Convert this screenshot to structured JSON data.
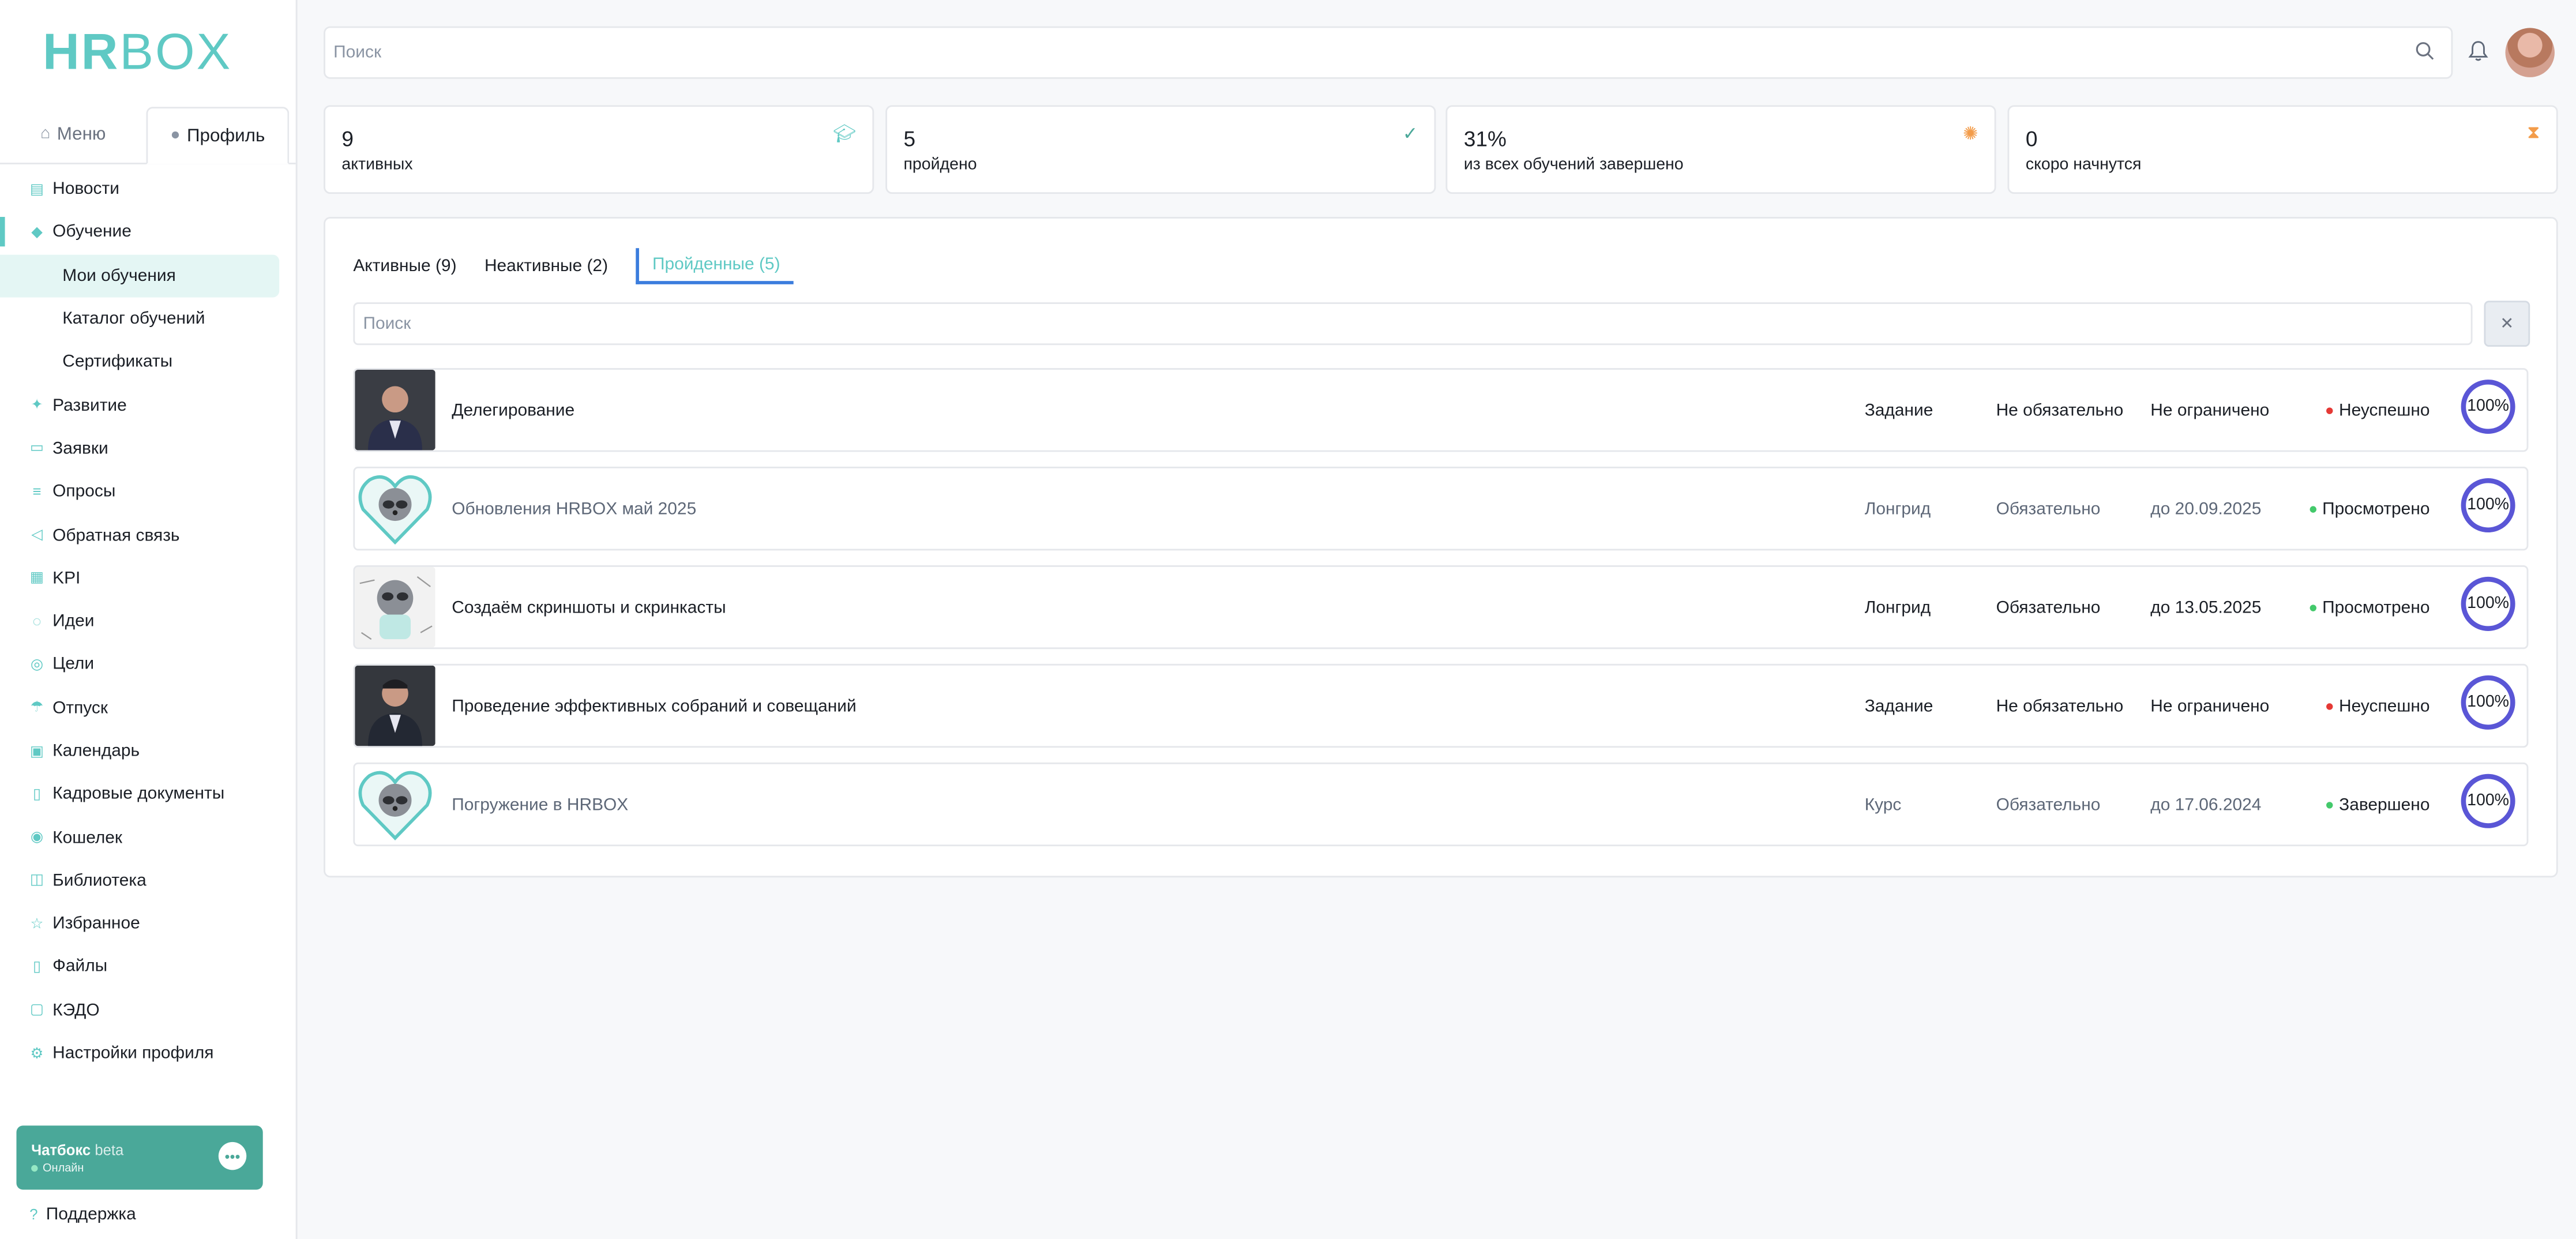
{
  "app": {
    "logo_bold": "HR",
    "logo_light": "BOX"
  },
  "sidebar": {
    "tabs": [
      {
        "label": "Меню",
        "icon": "home-icon"
      },
      {
        "label": "Профиль",
        "icon": "user-icon"
      }
    ],
    "items": [
      {
        "label": "Новости",
        "icon": "news-icon"
      },
      {
        "label": "Обучение",
        "icon": "graduation-cap-icon",
        "active": true
      },
      {
        "label": "Мои обучения",
        "sub": true,
        "selected": true
      },
      {
        "label": "Каталог обучений",
        "sub": true
      },
      {
        "label": "Сертификаты",
        "sub": true
      },
      {
        "label": "Развитие",
        "icon": "plant-icon"
      },
      {
        "label": "Заявки",
        "icon": "clipboard-icon"
      },
      {
        "label": "Опросы",
        "icon": "survey-icon"
      },
      {
        "label": "Обратная связь",
        "icon": "megaphone-icon"
      },
      {
        "label": "KPI",
        "icon": "kpi-icon"
      },
      {
        "label": "Идеи",
        "icon": "lightbulb-icon"
      },
      {
        "label": "Цели",
        "icon": "target-icon"
      },
      {
        "label": "Отпуск",
        "icon": "umbrella-icon"
      },
      {
        "label": "Календарь",
        "icon": "calendar-icon"
      },
      {
        "label": "Кадровые документы",
        "icon": "document-icon"
      },
      {
        "label": "Кошелек",
        "icon": "coins-icon"
      },
      {
        "label": "Библиотека",
        "icon": "book-icon"
      },
      {
        "label": "Избранное",
        "icon": "star-icon"
      },
      {
        "label": "Файлы",
        "icon": "file-icon"
      },
      {
        "label": "КЭДО",
        "icon": "edo-icon"
      },
      {
        "label": "Настройки профиля",
        "icon": "gear-icon"
      }
    ],
    "chat": {
      "title": "Чатбокс",
      "badge": "beta",
      "status": "Онлайн"
    },
    "support": "Поддержка"
  },
  "header": {
    "search_placeholder": "Поиск"
  },
  "stats": [
    {
      "value": "9",
      "label": "активных",
      "icon": "graduation-cap-icon",
      "color": "#5fc9c4"
    },
    {
      "value": "5",
      "label": "пройдено",
      "icon": "check-icon",
      "color": "#4aa899"
    },
    {
      "value": "31%",
      "label": "из всех обучений завершено",
      "icon": "spinner-icon",
      "color": "#f39c4a"
    },
    {
      "value": "0",
      "label": "скоро начнутся",
      "icon": "hourglass-icon",
      "color": "#f39c4a"
    }
  ],
  "tabs": [
    {
      "label": "Активные (9)"
    },
    {
      "label": "Неактивные (2)"
    },
    {
      "label": "Пройденные (5)",
      "active": true
    }
  ],
  "list_search_placeholder": "Поиск",
  "rows": [
    {
      "title": "Делегирование",
      "type": "Задание",
      "required": "Не обязательно",
      "deadline": "Не ограничено",
      "status": "Неуспешно",
      "status_color": "#e53935",
      "progress": "100%",
      "thumb": "photo-man",
      "muted": false
    },
    {
      "title": "Обновления HRBOX май 2025",
      "type": "Лонгрид",
      "required": "Обязательно",
      "deadline": "до 20.09.2025",
      "status": "Просмотрено",
      "status_color": "#43c96b",
      "progress": "100%",
      "thumb": "heart-raccoon",
      "muted": true
    },
    {
      "title": "Создаём скриншоты и скринкасты",
      "type": "Лонгрид",
      "required": "Обязательно",
      "deadline": "до 13.05.2025",
      "status": "Просмотрено",
      "status_color": "#43c96b",
      "progress": "100%",
      "thumb": "raccoon-sketch",
      "muted": false
    },
    {
      "title": "Проведение эффективных собраний и совещаний",
      "type": "Задание",
      "required": "Не обязательно",
      "deadline": "Не ограничено",
      "status": "Неуспешно",
      "status_color": "#e53935",
      "progress": "100%",
      "thumb": "photo-man",
      "muted": false
    },
    {
      "title": "Погружение в HRBOX",
      "type": "Курс",
      "required": "Обязательно",
      "deadline": "до 17.06.2024",
      "status": "Завершено",
      "status_color": "#43c96b",
      "progress": "100%",
      "thumb": "heart-raccoon",
      "muted": true
    }
  ],
  "colors": {
    "accent": "#5fc9c4",
    "progress_ring": "#5a56d6"
  }
}
